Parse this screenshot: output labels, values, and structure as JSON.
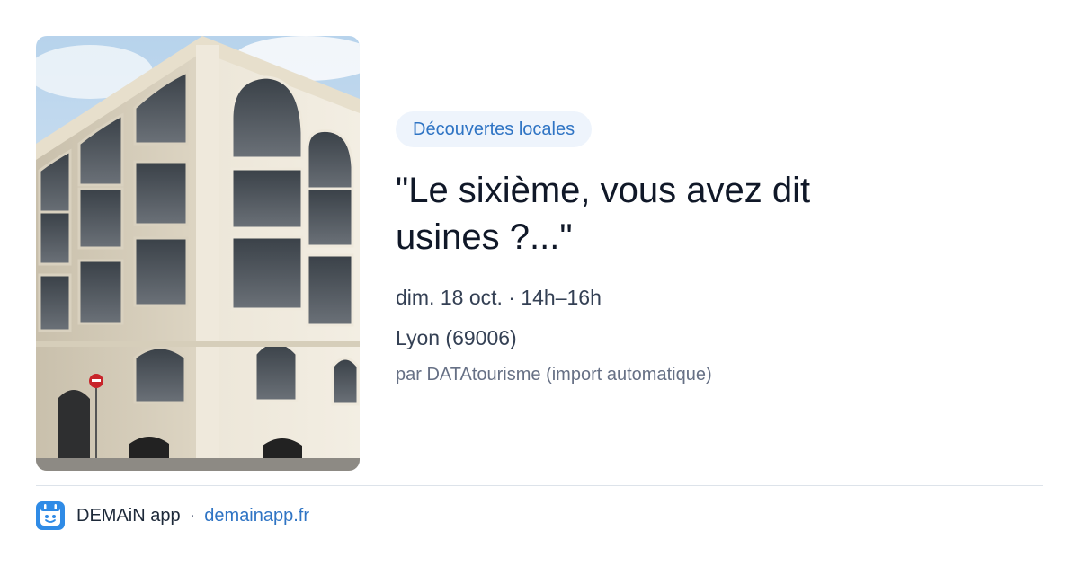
{
  "event": {
    "category": "Découvertes locales",
    "title": "\"Le sixième, vous avez dit usines ?...\"",
    "date": "dim. 18 oct. · 14h–16h",
    "location": "Lyon (69006)",
    "source": "par DATAtourisme (import automatique)"
  },
  "footer": {
    "app_name": "DEMAiN app",
    "separator": "·",
    "link": "demainapp.fr"
  },
  "colors": {
    "accent": "#2f74c4",
    "badge_bg": "#eef4fc",
    "title": "#101828",
    "muted": "#667085"
  },
  "icons": {
    "photo": "building-photo",
    "logo": "demain-app-logo-icon"
  }
}
